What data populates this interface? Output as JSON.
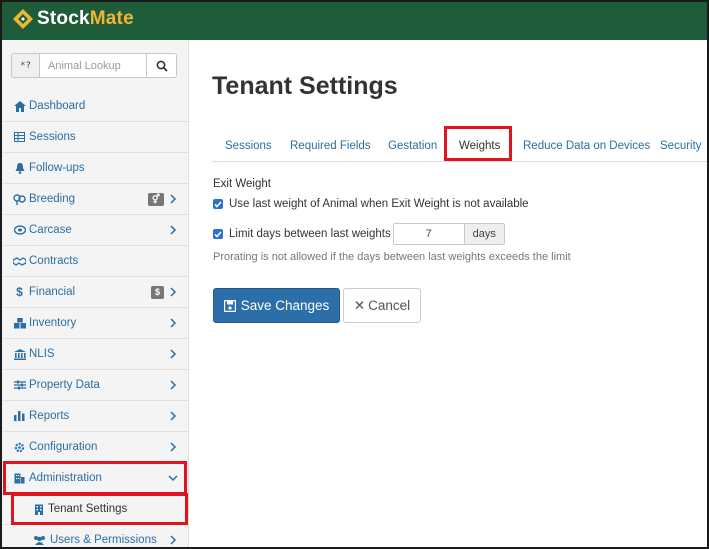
{
  "header": {
    "brand_part1": "Stock",
    "brand_part2": "Mate",
    "bg_color": "#1f5c3a",
    "accent_color": "#f2b531"
  },
  "sidebar": {
    "search": {
      "prefix": "*?",
      "placeholder": "Animal Lookup",
      "icon": "search-icon"
    },
    "items": [
      {
        "label": "Dashboard",
        "icon": "home-icon"
      },
      {
        "label": "Sessions",
        "icon": "table-icon"
      },
      {
        "label": "Follow-ups",
        "icon": "bell-icon"
      },
      {
        "label": "Breeding",
        "icon": "breeding-icon",
        "badge": "⚥",
        "has_chevron": true
      },
      {
        "label": "Carcase",
        "icon": "carcase-icon",
        "has_chevron": true
      },
      {
        "label": "Contracts",
        "icon": "handshake-icon"
      },
      {
        "label": "Financial",
        "icon": "dollar-icon",
        "badge": "$",
        "has_chevron": true
      },
      {
        "label": "Inventory",
        "icon": "boxes-icon",
        "has_chevron": true
      },
      {
        "label": "NLIS",
        "icon": "bank-icon",
        "has_chevron": true
      },
      {
        "label": "Property Data",
        "icon": "sliders-icon",
        "has_chevron": true
      },
      {
        "label": "Reports",
        "icon": "bar-chart-icon",
        "has_chevron": true
      },
      {
        "label": "Configuration",
        "icon": "gear-icon",
        "has_chevron": true
      },
      {
        "label": "Administration",
        "icon": "building-icon",
        "has_chevron": true,
        "expanded": true
      }
    ],
    "sub_items": [
      {
        "label": "Tenant Settings",
        "icon": "building-icon",
        "active": true
      },
      {
        "label": "Users & Permissions",
        "icon": "users-icon",
        "has_chevron": true
      }
    ]
  },
  "main": {
    "title": "Tenant Settings",
    "tabs": [
      {
        "label": "Sessions"
      },
      {
        "label": "Required Fields"
      },
      {
        "label": "Gestation"
      },
      {
        "label": "Weights",
        "active": true
      },
      {
        "label": "Reduce Data on Devices"
      },
      {
        "label": "Security"
      }
    ],
    "exit_weight": {
      "label": "Exit Weight",
      "option1": "Use last weight of Animal when Exit Weight is not available",
      "option1_checked": true,
      "option2": "Limit days between last weights",
      "option2_checked": true,
      "days_value": "7",
      "days_suffix": "days",
      "help_text": "Prorating is not allowed if the days between last weights exceeds the limit"
    },
    "buttons": {
      "save": "Save Changes",
      "cancel": "Cancel"
    }
  },
  "highlight_color": "#e0141e"
}
